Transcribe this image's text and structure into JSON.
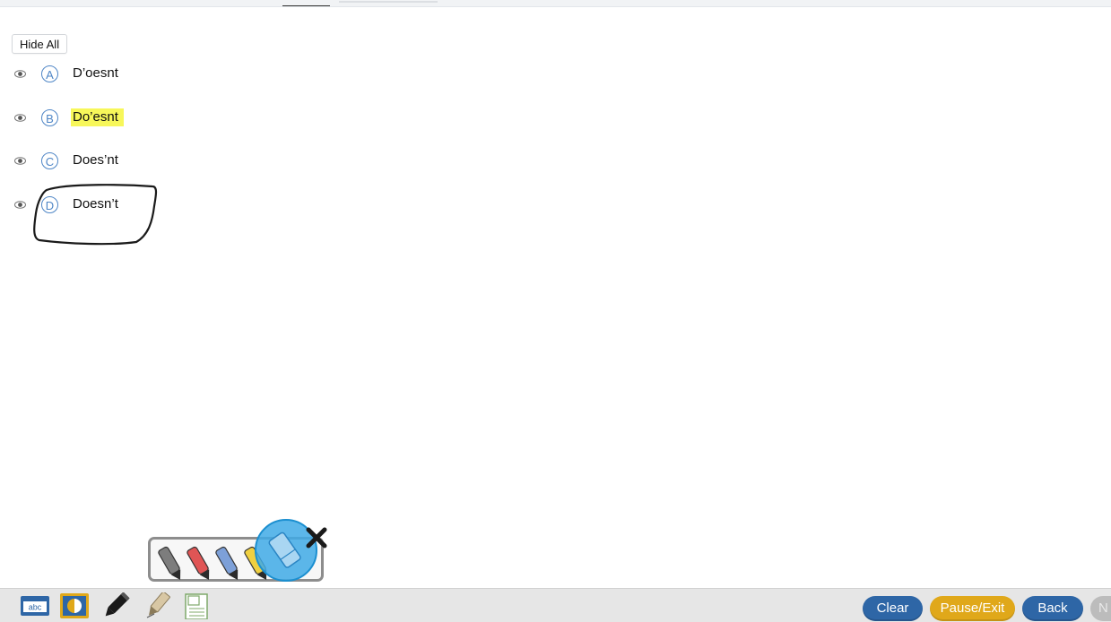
{
  "hide_all_label": "Hide All",
  "options": [
    {
      "letter": "A",
      "text": "D’oesnt",
      "highlighted": false
    },
    {
      "letter": "B",
      "text": "Do’esnt",
      "highlighted": true
    },
    {
      "letter": "C",
      "text": "Does’nt",
      "highlighted": false
    },
    {
      "letter": "D",
      "text": "Doesn’t",
      "highlighted": false
    }
  ],
  "toolbar": {
    "tools": [
      "text-abc-icon",
      "contrast-icon",
      "pencil-icon",
      "highlighter-icon",
      "notes-icon"
    ],
    "abc_label": "abc",
    "clear_label": "Clear",
    "pause_label": "Pause/Exit",
    "back_label": "Back",
    "next_label": "N"
  },
  "palette": {
    "markers": [
      "grey-marker-icon",
      "red-marker-icon",
      "blue-marker-icon",
      "yellow-marker-icon",
      "eraser-icon"
    ],
    "selected": "eraser-icon"
  },
  "colors": {
    "accent_blue": "#2e66a6",
    "gold": "#e0a81a",
    "highlight_yellow": "#f7f75a",
    "letter_blue": "#4f86c6"
  }
}
